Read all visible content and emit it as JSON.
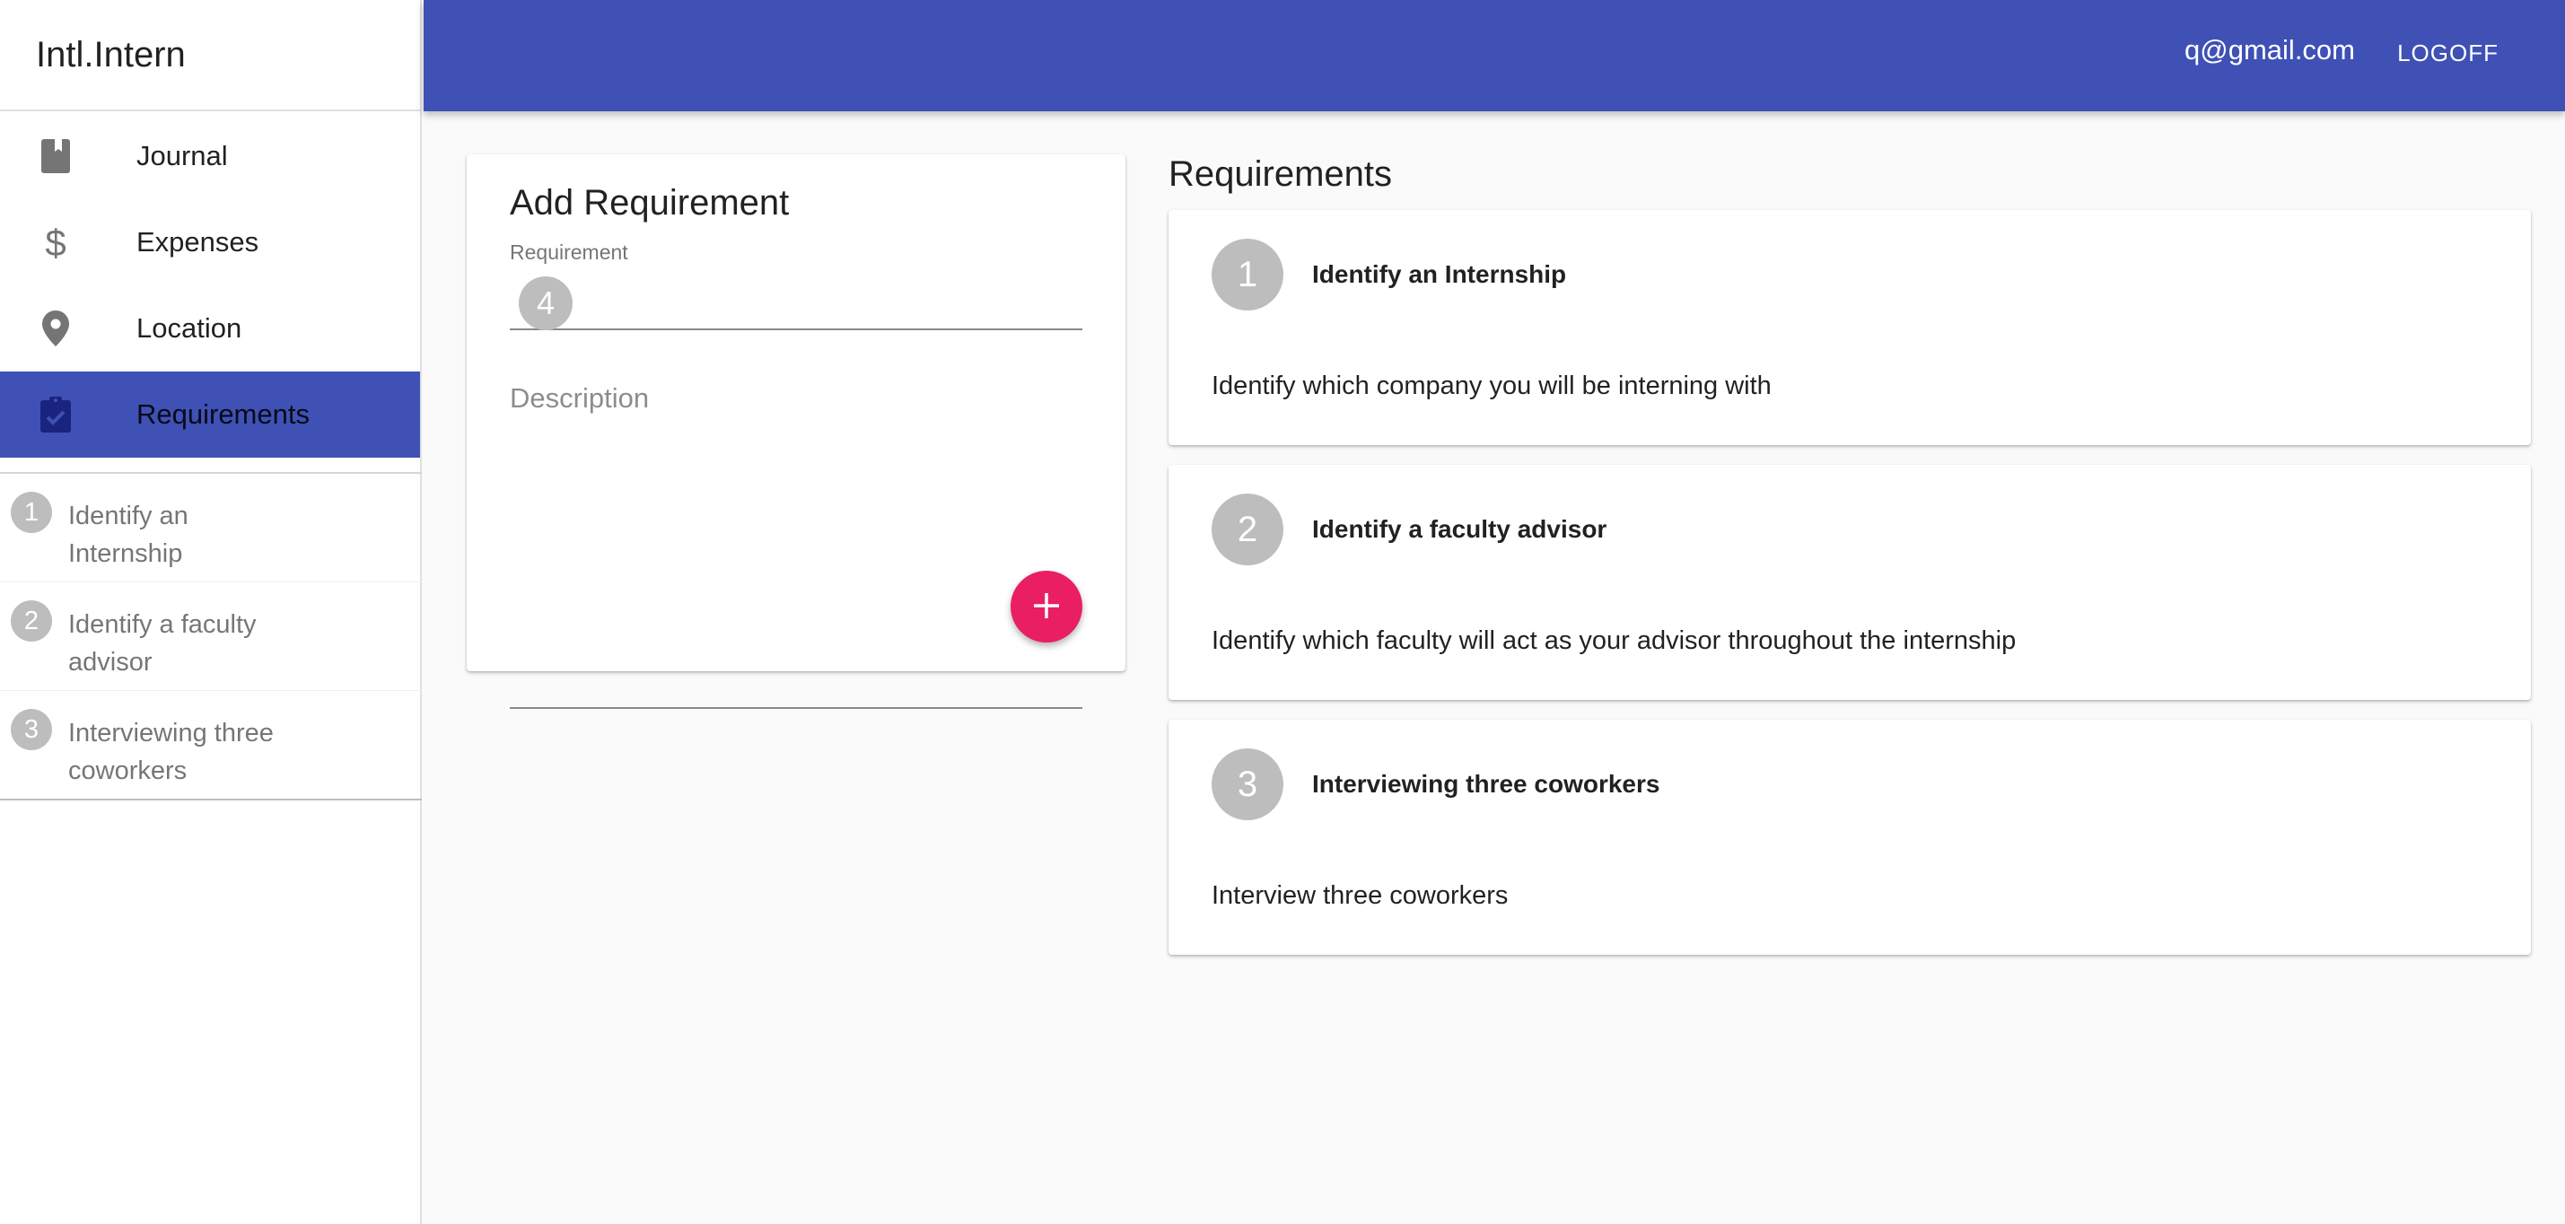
{
  "app": {
    "brand": "Intl.Intern"
  },
  "header": {
    "user_email": "q@gmail.com",
    "logoff_label": "LOGOFF"
  },
  "nav": {
    "items": [
      {
        "label": "Journal",
        "icon": "book-icon",
        "active": false
      },
      {
        "label": "Expenses",
        "icon": "dollar-icon",
        "active": false
      },
      {
        "label": "Location",
        "icon": "location-pin-icon",
        "active": false
      },
      {
        "label": "Requirements",
        "icon": "clipboard-check-icon",
        "active": true
      }
    ],
    "sub_items": [
      {
        "num": "1",
        "label": "Identify an Internship"
      },
      {
        "num": "2",
        "label": "Identify a faculty advisor"
      },
      {
        "num": "3",
        "label": "Interviewing three coworkers"
      }
    ]
  },
  "add_form": {
    "title": "Add Requirement",
    "requirement_label": "Requirement",
    "requirement_value": "4",
    "description_placeholder": "Description",
    "description_value": "",
    "add_button_icon": "plus-icon"
  },
  "requirements": {
    "heading": "Requirements",
    "items": [
      {
        "num": "1",
        "title": "Identify an Internship",
        "description": "Identify which company you will be interning with"
      },
      {
        "num": "2",
        "title": "Identify a faculty advisor",
        "description": "Identify which faculty will act as your advisor throughout the internship"
      },
      {
        "num": "3",
        "title": "Interviewing three coworkers",
        "description": "Interview three coworkers"
      }
    ]
  },
  "colors": {
    "primary": "#3f51b5",
    "accent": "#e91e63",
    "chip": "#bdbdbd",
    "active_icon": "#1a237e"
  }
}
